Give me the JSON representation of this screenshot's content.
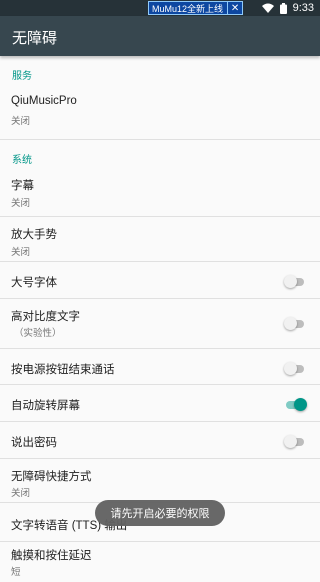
{
  "statusbar": {
    "notification_text": "MuMu12全新上线",
    "notification_close": "✕",
    "time": "9:33"
  },
  "appbar": {
    "title": "无障碍"
  },
  "sections": {
    "services_header": "服务",
    "system_header": "系统"
  },
  "items": {
    "qiumusic": {
      "title": "QiuMusicPro",
      "subtitle": "关闭"
    },
    "captions": {
      "title": "字幕",
      "subtitle": "关闭"
    },
    "magnification": {
      "title": "放大手势",
      "subtitle": "关闭"
    },
    "large_text": {
      "title": "大号字体",
      "checked": false
    },
    "high_contrast": {
      "title": "高对比度文字",
      "subtitle": "（实验性）",
      "checked": false
    },
    "power_ends_call": {
      "title": "按电源按钮结束通话",
      "checked": false
    },
    "auto_rotate": {
      "title": "自动旋转屏幕",
      "checked": true
    },
    "speak_passwords": {
      "title": "说出密码",
      "checked": false
    },
    "shortcut": {
      "title": "无障碍快捷方式",
      "subtitle": "关闭"
    },
    "tts": {
      "title": "文字转语音 (TTS) 输出"
    },
    "touch_hold": {
      "title": "触摸和按住延迟",
      "subtitle": "短"
    }
  },
  "toast": {
    "text": "请先开启必要的权限"
  },
  "colors": {
    "accent": "#009688",
    "appbar": "#37474f",
    "statusbar": "#263238"
  }
}
